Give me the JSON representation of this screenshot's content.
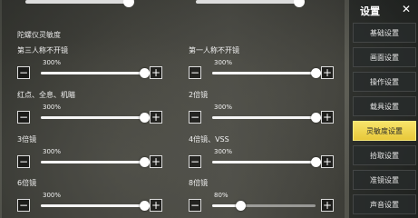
{
  "section": {
    "title": "陀螺仪灵敏度"
  },
  "top_sliders": [
    {
      "level": 1.0
    },
    {
      "level": 1.0
    }
  ],
  "settings": [
    {
      "label": "第三人称不开镜",
      "value": "300%",
      "level": 1.0
    },
    {
      "label": "第一人称不开镜",
      "value": "300%",
      "level": 1.0
    },
    {
      "label": "红点、全息、机瞄",
      "value": "300%",
      "level": 1.0
    },
    {
      "label": "2倍镜",
      "value": "300%",
      "level": 1.0
    },
    {
      "label": "3倍镜",
      "value": "300%",
      "level": 1.0
    },
    {
      "label": "4倍镜、VSS",
      "value": "300%",
      "level": 1.0
    },
    {
      "label": "6倍镜",
      "value": "300%",
      "level": 1.0
    },
    {
      "label": "8倍镜",
      "value": "80%",
      "level": 0.27
    }
  ],
  "controls": {
    "minus": "−",
    "plus": "+"
  },
  "sidebar": {
    "title": "设置",
    "close": "✕",
    "items": [
      {
        "label": "基础设置",
        "active": false
      },
      {
        "label": "画面设置",
        "active": false
      },
      {
        "label": "操作设置",
        "active": false
      },
      {
        "label": "载具设置",
        "active": false
      },
      {
        "label": "灵敏度设置",
        "active": true
      },
      {
        "label": "拾取设置",
        "active": false
      },
      {
        "label": "准镜设置",
        "active": false
      },
      {
        "label": "声音设置",
        "active": false
      }
    ]
  }
}
